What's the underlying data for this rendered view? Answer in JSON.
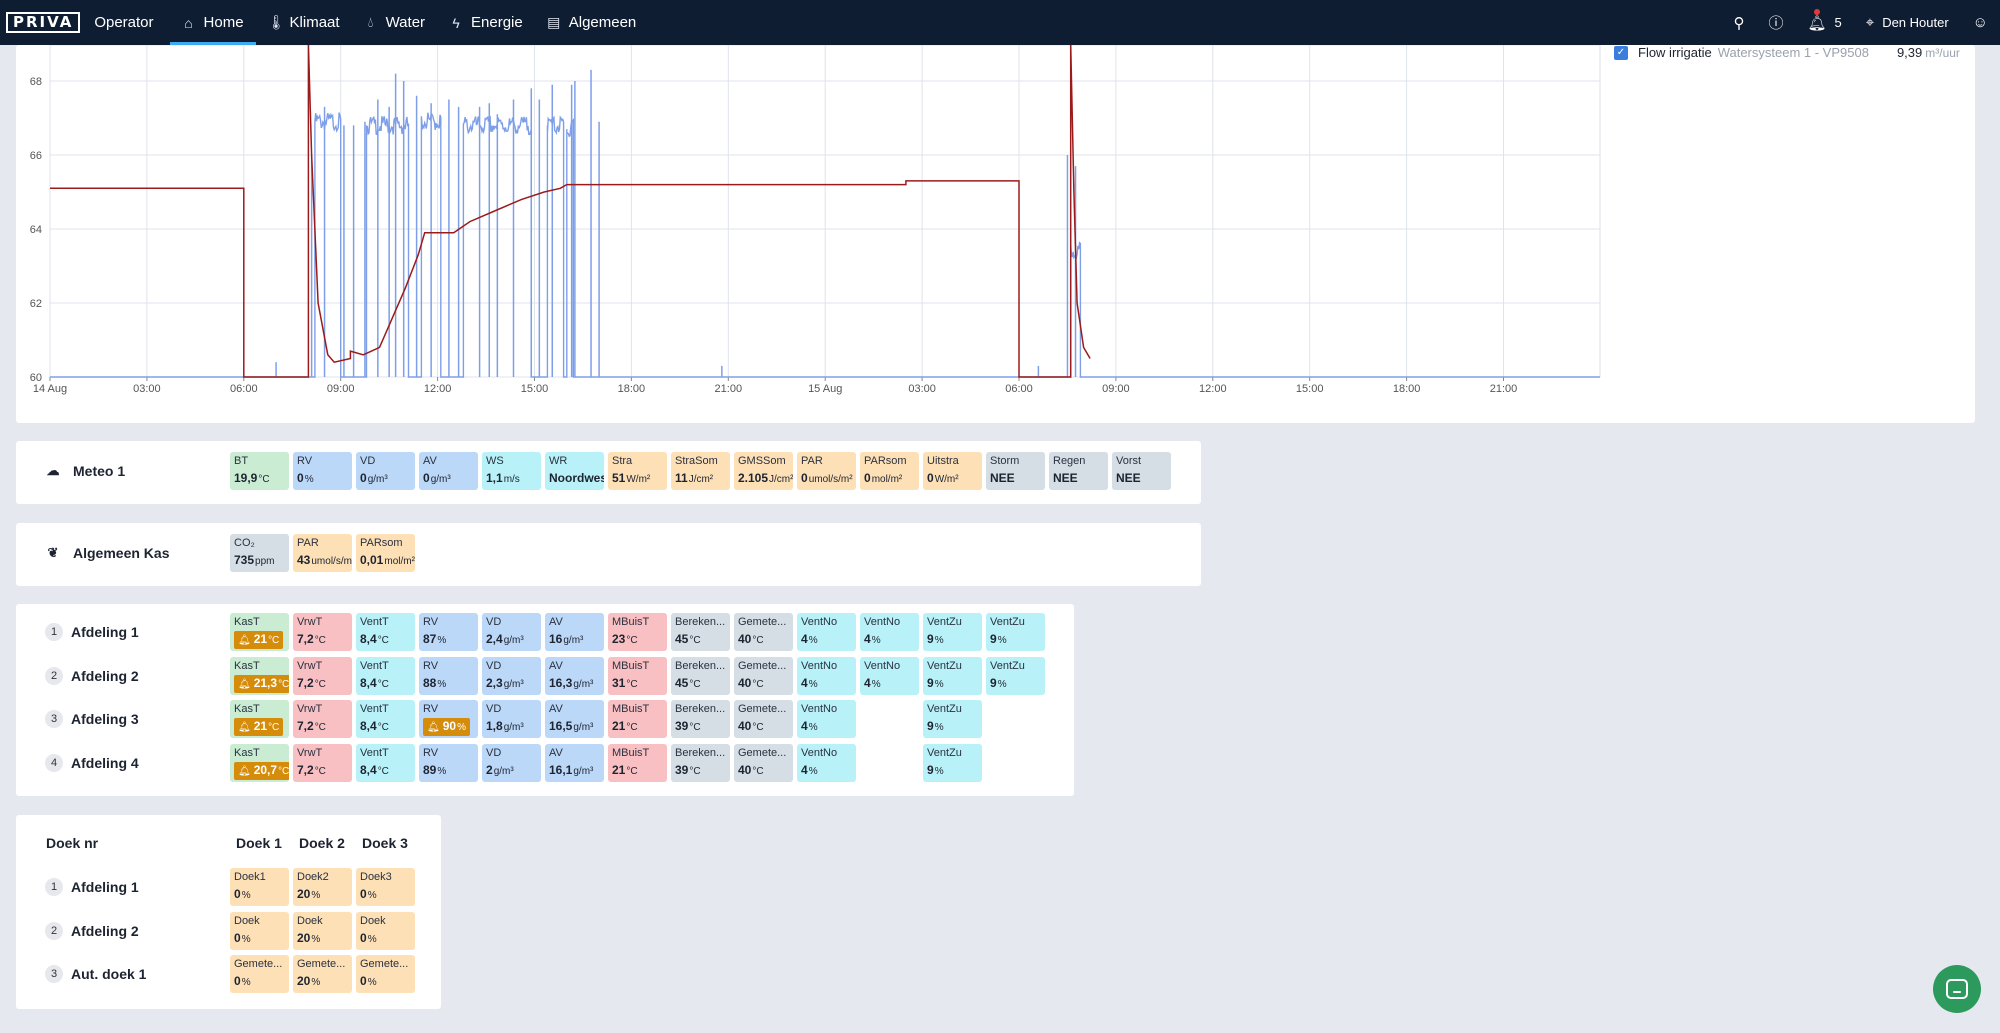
{
  "nav": {
    "logo": "PRIVA",
    "app": "Operator",
    "items": [
      {
        "label": "Home",
        "icon": "home-icon",
        "active": true
      },
      {
        "label": "Klimaat",
        "icon": "thermometer-icon",
        "active": false
      },
      {
        "label": "Water",
        "icon": "droplet-icon",
        "active": false
      },
      {
        "label": "Energie",
        "icon": "lightning-icon",
        "active": false
      },
      {
        "label": "Algemeen",
        "icon": "toolbox-icon",
        "active": false
      }
    ],
    "notifications": "5",
    "location": "Den Houter"
  },
  "chart_legend": {
    "name": "Flow irrigatie",
    "sub": "Watersysteem 1 - VP9508",
    "value": "9,39",
    "unit": "m³/uur"
  },
  "chart_data": {
    "type": "line",
    "xlabel": "",
    "ylabel": "",
    "x_ticks": [
      "14 Aug",
      "03:00",
      "06:00",
      "09:00",
      "12:00",
      "15:00",
      "18:00",
      "21:00",
      "15 Aug",
      "03:00",
      "06:00",
      "09:00",
      "12:00",
      "15:00",
      "18:00",
      "21:00"
    ],
    "x_range_hours": [
      0,
      48
    ],
    "y_ticks": [
      60,
      62,
      64,
      66,
      68
    ],
    "ylim": [
      60,
      69
    ],
    "grid": true,
    "series": [
      {
        "color": "#9b1b1b",
        "points": [
          [
            0,
            65.1
          ],
          [
            6.0,
            65.1
          ],
          [
            6.0,
            60
          ],
          [
            8.0,
            60
          ],
          [
            8.0,
            69
          ],
          [
            8.1,
            66
          ],
          [
            8.3,
            62
          ],
          [
            8.6,
            60.6
          ],
          [
            8.8,
            60.4
          ],
          [
            9.3,
            60.5
          ],
          [
            9.3,
            60.7
          ],
          [
            9.7,
            60.6
          ],
          [
            10.2,
            60.8
          ],
          [
            10.6,
            61.6
          ],
          [
            11.0,
            62.4
          ],
          [
            11.4,
            63.3
          ],
          [
            11.6,
            63.9
          ],
          [
            12.5,
            63.9
          ],
          [
            13.0,
            64.2
          ],
          [
            13.8,
            64.5
          ],
          [
            14.6,
            64.8
          ],
          [
            15.3,
            65.0
          ],
          [
            15.8,
            65.1
          ],
          [
            16.0,
            65.2
          ],
          [
            26.5,
            65.2
          ],
          [
            26.5,
            65.3
          ],
          [
            30.0,
            65.3
          ],
          [
            30.0,
            60
          ],
          [
            31.6,
            60
          ],
          [
            31.6,
            69
          ],
          [
            31.7,
            65
          ],
          [
            31.8,
            62
          ],
          [
            32.0,
            60.8
          ],
          [
            32.2,
            60.5
          ]
        ]
      },
      {
        "color": "#7e9fe8",
        "segments": [
          [
            8.2,
            9.0,
            66.9
          ],
          [
            9.8,
            11.1,
            66.8
          ],
          [
            11.5,
            12.1,
            66.9
          ],
          [
            12.8,
            14.9,
            66.8
          ],
          [
            15.4,
            15.9,
            66.8
          ],
          [
            16.0,
            16.2,
            66.7
          ],
          [
            31.6,
            31.9,
            63.4
          ]
        ],
        "spikes": [
          [
            8.1,
            66.0
          ],
          [
            8.5,
            67.3
          ],
          [
            9.1,
            66.8
          ],
          [
            9.4,
            66.8
          ],
          [
            9.75,
            66.9
          ],
          [
            10.15,
            67.5
          ],
          [
            10.5,
            67.3
          ],
          [
            10.7,
            68.2
          ],
          [
            10.95,
            68.0
          ],
          [
            11.35,
            67.6
          ],
          [
            11.8,
            67.4
          ],
          [
            12.35,
            67.5
          ],
          [
            12.65,
            67.3
          ],
          [
            13.3,
            67.3
          ],
          [
            13.6,
            67.4
          ],
          [
            13.85,
            67.1
          ],
          [
            14.35,
            67.5
          ],
          [
            14.9,
            67.8
          ],
          [
            15.15,
            67.5
          ],
          [
            15.55,
            67.9
          ],
          [
            16.15,
            67.9
          ],
          [
            16.25,
            68.0
          ],
          [
            16.75,
            68.3
          ],
          [
            17.0,
            66.9
          ],
          [
            31.5,
            66.0
          ],
          [
            31.75,
            65.7
          ],
          [
            7.0,
            60.4
          ],
          [
            20.8,
            60.3
          ],
          [
            30.6,
            60.3
          ]
        ]
      }
    ]
  },
  "meteo": {
    "title": "Meteo 1",
    "tiles": [
      {
        "label": "BT",
        "value": "19,9",
        "unit": "°C",
        "color": "green"
      },
      {
        "label": "RV",
        "value": "0",
        "unit": "%",
        "color": "blue"
      },
      {
        "label": "VD",
        "value": "0",
        "unit": "g/m³",
        "color": "blue"
      },
      {
        "label": "AV",
        "value": "0",
        "unit": "g/m³",
        "color": "blue"
      },
      {
        "label": "WS",
        "value": "1,1",
        "unit": "m/s",
        "color": "cyan"
      },
      {
        "label": "WR",
        "value": "Noordwest",
        "unit": "",
        "color": "cyan"
      },
      {
        "label": "Stra",
        "value": "51",
        "unit": "W/m²",
        "color": "orange"
      },
      {
        "label": "StraSom",
        "value": "11",
        "unit": "J/cm²",
        "color": "orange"
      },
      {
        "label": "GMSSom",
        "value": "2.105",
        "unit": "J/cm²",
        "color": "orange"
      },
      {
        "label": "PAR",
        "value": "0",
        "unit": "umol/s/m²",
        "color": "orange"
      },
      {
        "label": "PARsom",
        "value": "0",
        "unit": "mol/m²",
        "color": "orange"
      },
      {
        "label": "Uitstra",
        "value": "0",
        "unit": "W/m²",
        "color": "orange"
      },
      {
        "label": "Storm",
        "value": "NEE",
        "unit": "",
        "color": "gray"
      },
      {
        "label": "Regen",
        "value": "NEE",
        "unit": "",
        "color": "gray"
      },
      {
        "label": "Vorst",
        "value": "NEE",
        "unit": "",
        "color": "gray"
      }
    ]
  },
  "algemeen": {
    "title": "Algemeen Kas",
    "tiles": [
      {
        "label": "CO₂",
        "value": "735",
        "unit": "ppm",
        "color": "gray"
      },
      {
        "label": "PAR",
        "value": "43",
        "unit": "umol/s/m²",
        "color": "orange"
      },
      {
        "label": "PARsom",
        "value": "0,01",
        "unit": "mol/m²",
        "color": "orange"
      }
    ]
  },
  "afdelingen": [
    {
      "num": "1",
      "title": "Afdeling 1",
      "tiles": [
        {
          "label": "KasT",
          "value": "21",
          "unit": "°C",
          "color": "green",
          "alarm": true
        },
        {
          "label": "VrwT",
          "value": "7,2",
          "unit": "°C",
          "color": "red"
        },
        {
          "label": "VentT",
          "value": "8,4",
          "unit": "°C",
          "color": "cyan"
        },
        {
          "label": "RV",
          "value": "87",
          "unit": "%",
          "color": "blue"
        },
        {
          "label": "VD",
          "value": "2,4",
          "unit": "g/m³",
          "color": "blue"
        },
        {
          "label": "AV",
          "value": "16",
          "unit": "g/m³",
          "color": "blue"
        },
        {
          "label": "MBuisT",
          "value": "23",
          "unit": "°C",
          "color": "red"
        },
        {
          "label": "Bereken...",
          "value": "45",
          "unit": "°C",
          "color": "gray"
        },
        {
          "label": "Gemete...",
          "value": "40",
          "unit": "°C",
          "color": "gray"
        },
        {
          "label": "VentNo",
          "value": "4",
          "unit": "%",
          "color": "cyan"
        },
        {
          "label": "VentNo",
          "value": "4",
          "unit": "%",
          "color": "cyan"
        },
        {
          "label": "VentZu",
          "value": "9",
          "unit": "%",
          "color": "cyan"
        },
        {
          "label": "VentZu",
          "value": "9",
          "unit": "%",
          "color": "cyan"
        }
      ]
    },
    {
      "num": "2",
      "title": "Afdeling 2",
      "tiles": [
        {
          "label": "KasT",
          "value": "21,3",
          "unit": "°C",
          "color": "green",
          "alarm": true
        },
        {
          "label": "VrwT",
          "value": "7,2",
          "unit": "°C",
          "color": "red"
        },
        {
          "label": "VentT",
          "value": "8,4",
          "unit": "°C",
          "color": "cyan"
        },
        {
          "label": "RV",
          "value": "88",
          "unit": "%",
          "color": "blue"
        },
        {
          "label": "VD",
          "value": "2,3",
          "unit": "g/m³",
          "color": "blue"
        },
        {
          "label": "AV",
          "value": "16,3",
          "unit": "g/m³",
          "color": "blue"
        },
        {
          "label": "MBuisT",
          "value": "31",
          "unit": "°C",
          "color": "red"
        },
        {
          "label": "Bereken...",
          "value": "45",
          "unit": "°C",
          "color": "gray"
        },
        {
          "label": "Gemete...",
          "value": "40",
          "unit": "°C",
          "color": "gray"
        },
        {
          "label": "VentNo",
          "value": "4",
          "unit": "%",
          "color": "cyan"
        },
        {
          "label": "VentNo",
          "value": "4",
          "unit": "%",
          "color": "cyan"
        },
        {
          "label": "VentZu",
          "value": "9",
          "unit": "%",
          "color": "cyan"
        },
        {
          "label": "VentZu",
          "value": "9",
          "unit": "%",
          "color": "cyan"
        }
      ]
    },
    {
      "num": "3",
      "title": "Afdeling 3",
      "tiles": [
        {
          "label": "KasT",
          "value": "21",
          "unit": "°C",
          "color": "green",
          "alarm": true
        },
        {
          "label": "VrwT",
          "value": "7,2",
          "unit": "°C",
          "color": "red"
        },
        {
          "label": "VentT",
          "value": "8,4",
          "unit": "°C",
          "color": "cyan"
        },
        {
          "label": "RV",
          "value": "90",
          "unit": "%",
          "color": "blue",
          "alarm": true
        },
        {
          "label": "VD",
          "value": "1,8",
          "unit": "g/m³",
          "color": "blue"
        },
        {
          "label": "AV",
          "value": "16,5",
          "unit": "g/m³",
          "color": "blue"
        },
        {
          "label": "MBuisT",
          "value": "21",
          "unit": "°C",
          "color": "red"
        },
        {
          "label": "Bereken...",
          "value": "39",
          "unit": "°C",
          "color": "gray"
        },
        {
          "label": "Gemete...",
          "value": "40",
          "unit": "°C",
          "color": "gray"
        },
        {
          "label": "VentNo",
          "value": "4",
          "unit": "%",
          "color": "cyan"
        },
        {
          "gap": true
        },
        {
          "label": "VentZu",
          "value": "9",
          "unit": "%",
          "color": "cyan"
        }
      ]
    },
    {
      "num": "4",
      "title": "Afdeling 4",
      "tiles": [
        {
          "label": "KasT",
          "value": "20,7",
          "unit": "°C",
          "color": "green",
          "alarm": true
        },
        {
          "label": "VrwT",
          "value": "7,2",
          "unit": "°C",
          "color": "red"
        },
        {
          "label": "VentT",
          "value": "8,4",
          "unit": "°C",
          "color": "cyan"
        },
        {
          "label": "RV",
          "value": "89",
          "unit": "%",
          "color": "blue"
        },
        {
          "label": "VD",
          "value": "2",
          "unit": "g/m³",
          "color": "blue"
        },
        {
          "label": "AV",
          "value": "16,1",
          "unit": "g/m³",
          "color": "blue"
        },
        {
          "label": "MBuisT",
          "value": "21",
          "unit": "°C",
          "color": "red"
        },
        {
          "label": "Bereken...",
          "value": "39",
          "unit": "°C",
          "color": "gray"
        },
        {
          "label": "Gemete...",
          "value": "40",
          "unit": "°C",
          "color": "gray"
        },
        {
          "label": "VentNo",
          "value": "4",
          "unit": "%",
          "color": "cyan"
        },
        {
          "gap": true
        },
        {
          "label": "VentZu",
          "value": "9",
          "unit": "%",
          "color": "cyan"
        }
      ]
    }
  ],
  "doek": {
    "header": "Doek nr",
    "columns": [
      "Doek 1",
      "Doek 2",
      "Doek 3"
    ],
    "rows": [
      {
        "num": "1",
        "title": "Afdeling 1",
        "tiles": [
          {
            "label": "Doek1",
            "value": "0",
            "unit": "%",
            "color": "orange"
          },
          {
            "label": "Doek2",
            "value": "20",
            "unit": "%",
            "color": "orange"
          },
          {
            "label": "Doek3",
            "value": "0",
            "unit": "%",
            "color": "orange"
          }
        ]
      },
      {
        "num": "2",
        "title": "Afdeling 2",
        "tiles": [
          {
            "label": "Doek",
            "value": "0",
            "unit": "%",
            "color": "orange"
          },
          {
            "label": "Doek",
            "value": "20",
            "unit": "%",
            "color": "orange"
          },
          {
            "label": "Doek",
            "value": "0",
            "unit": "%",
            "color": "orange"
          }
        ]
      },
      {
        "num": "3",
        "title": "Aut. doek 1",
        "tiles": [
          {
            "label": "Gemete...",
            "value": "0",
            "unit": "%",
            "color": "orange"
          },
          {
            "label": "Gemete...",
            "value": "20",
            "unit": "%",
            "color": "orange"
          },
          {
            "label": "Gemete...",
            "value": "0",
            "unit": "%",
            "color": "orange"
          }
        ]
      }
    ]
  }
}
